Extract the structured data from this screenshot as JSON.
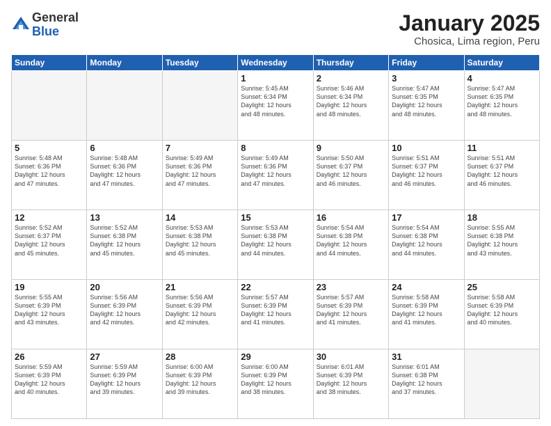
{
  "logo": {
    "general": "General",
    "blue": "Blue"
  },
  "title": "January 2025",
  "subtitle": "Chosica, Lima region, Peru",
  "days_header": [
    "Sunday",
    "Monday",
    "Tuesday",
    "Wednesday",
    "Thursday",
    "Friday",
    "Saturday"
  ],
  "weeks": [
    [
      {
        "num": "",
        "info": ""
      },
      {
        "num": "",
        "info": ""
      },
      {
        "num": "",
        "info": ""
      },
      {
        "num": "1",
        "info": "Sunrise: 5:45 AM\nSunset: 6:34 PM\nDaylight: 12 hours\nand 48 minutes."
      },
      {
        "num": "2",
        "info": "Sunrise: 5:46 AM\nSunset: 6:34 PM\nDaylight: 12 hours\nand 48 minutes."
      },
      {
        "num": "3",
        "info": "Sunrise: 5:47 AM\nSunset: 6:35 PM\nDaylight: 12 hours\nand 48 minutes."
      },
      {
        "num": "4",
        "info": "Sunrise: 5:47 AM\nSunset: 6:35 PM\nDaylight: 12 hours\nand 48 minutes."
      }
    ],
    [
      {
        "num": "5",
        "info": "Sunrise: 5:48 AM\nSunset: 6:36 PM\nDaylight: 12 hours\nand 47 minutes."
      },
      {
        "num": "6",
        "info": "Sunrise: 5:48 AM\nSunset: 6:36 PM\nDaylight: 12 hours\nand 47 minutes."
      },
      {
        "num": "7",
        "info": "Sunrise: 5:49 AM\nSunset: 6:36 PM\nDaylight: 12 hours\nand 47 minutes."
      },
      {
        "num": "8",
        "info": "Sunrise: 5:49 AM\nSunset: 6:36 PM\nDaylight: 12 hours\nand 47 minutes."
      },
      {
        "num": "9",
        "info": "Sunrise: 5:50 AM\nSunset: 6:37 PM\nDaylight: 12 hours\nand 46 minutes."
      },
      {
        "num": "10",
        "info": "Sunrise: 5:51 AM\nSunset: 6:37 PM\nDaylight: 12 hours\nand 46 minutes."
      },
      {
        "num": "11",
        "info": "Sunrise: 5:51 AM\nSunset: 6:37 PM\nDaylight: 12 hours\nand 46 minutes."
      }
    ],
    [
      {
        "num": "12",
        "info": "Sunrise: 5:52 AM\nSunset: 6:37 PM\nDaylight: 12 hours\nand 45 minutes."
      },
      {
        "num": "13",
        "info": "Sunrise: 5:52 AM\nSunset: 6:38 PM\nDaylight: 12 hours\nand 45 minutes."
      },
      {
        "num": "14",
        "info": "Sunrise: 5:53 AM\nSunset: 6:38 PM\nDaylight: 12 hours\nand 45 minutes."
      },
      {
        "num": "15",
        "info": "Sunrise: 5:53 AM\nSunset: 6:38 PM\nDaylight: 12 hours\nand 44 minutes."
      },
      {
        "num": "16",
        "info": "Sunrise: 5:54 AM\nSunset: 6:38 PM\nDaylight: 12 hours\nand 44 minutes."
      },
      {
        "num": "17",
        "info": "Sunrise: 5:54 AM\nSunset: 6:38 PM\nDaylight: 12 hours\nand 44 minutes."
      },
      {
        "num": "18",
        "info": "Sunrise: 5:55 AM\nSunset: 6:38 PM\nDaylight: 12 hours\nand 43 minutes."
      }
    ],
    [
      {
        "num": "19",
        "info": "Sunrise: 5:55 AM\nSunset: 6:39 PM\nDaylight: 12 hours\nand 43 minutes."
      },
      {
        "num": "20",
        "info": "Sunrise: 5:56 AM\nSunset: 6:39 PM\nDaylight: 12 hours\nand 42 minutes."
      },
      {
        "num": "21",
        "info": "Sunrise: 5:56 AM\nSunset: 6:39 PM\nDaylight: 12 hours\nand 42 minutes."
      },
      {
        "num": "22",
        "info": "Sunrise: 5:57 AM\nSunset: 6:39 PM\nDaylight: 12 hours\nand 41 minutes."
      },
      {
        "num": "23",
        "info": "Sunrise: 5:57 AM\nSunset: 6:39 PM\nDaylight: 12 hours\nand 41 minutes."
      },
      {
        "num": "24",
        "info": "Sunrise: 5:58 AM\nSunset: 6:39 PM\nDaylight: 12 hours\nand 41 minutes."
      },
      {
        "num": "25",
        "info": "Sunrise: 5:58 AM\nSunset: 6:39 PM\nDaylight: 12 hours\nand 40 minutes."
      }
    ],
    [
      {
        "num": "26",
        "info": "Sunrise: 5:59 AM\nSunset: 6:39 PM\nDaylight: 12 hours\nand 40 minutes."
      },
      {
        "num": "27",
        "info": "Sunrise: 5:59 AM\nSunset: 6:39 PM\nDaylight: 12 hours\nand 39 minutes."
      },
      {
        "num": "28",
        "info": "Sunrise: 6:00 AM\nSunset: 6:39 PM\nDaylight: 12 hours\nand 39 minutes."
      },
      {
        "num": "29",
        "info": "Sunrise: 6:00 AM\nSunset: 6:39 PM\nDaylight: 12 hours\nand 38 minutes."
      },
      {
        "num": "30",
        "info": "Sunrise: 6:01 AM\nSunset: 6:39 PM\nDaylight: 12 hours\nand 38 minutes."
      },
      {
        "num": "31",
        "info": "Sunrise: 6:01 AM\nSunset: 6:38 PM\nDaylight: 12 hours\nand 37 minutes."
      },
      {
        "num": "",
        "info": ""
      }
    ]
  ]
}
